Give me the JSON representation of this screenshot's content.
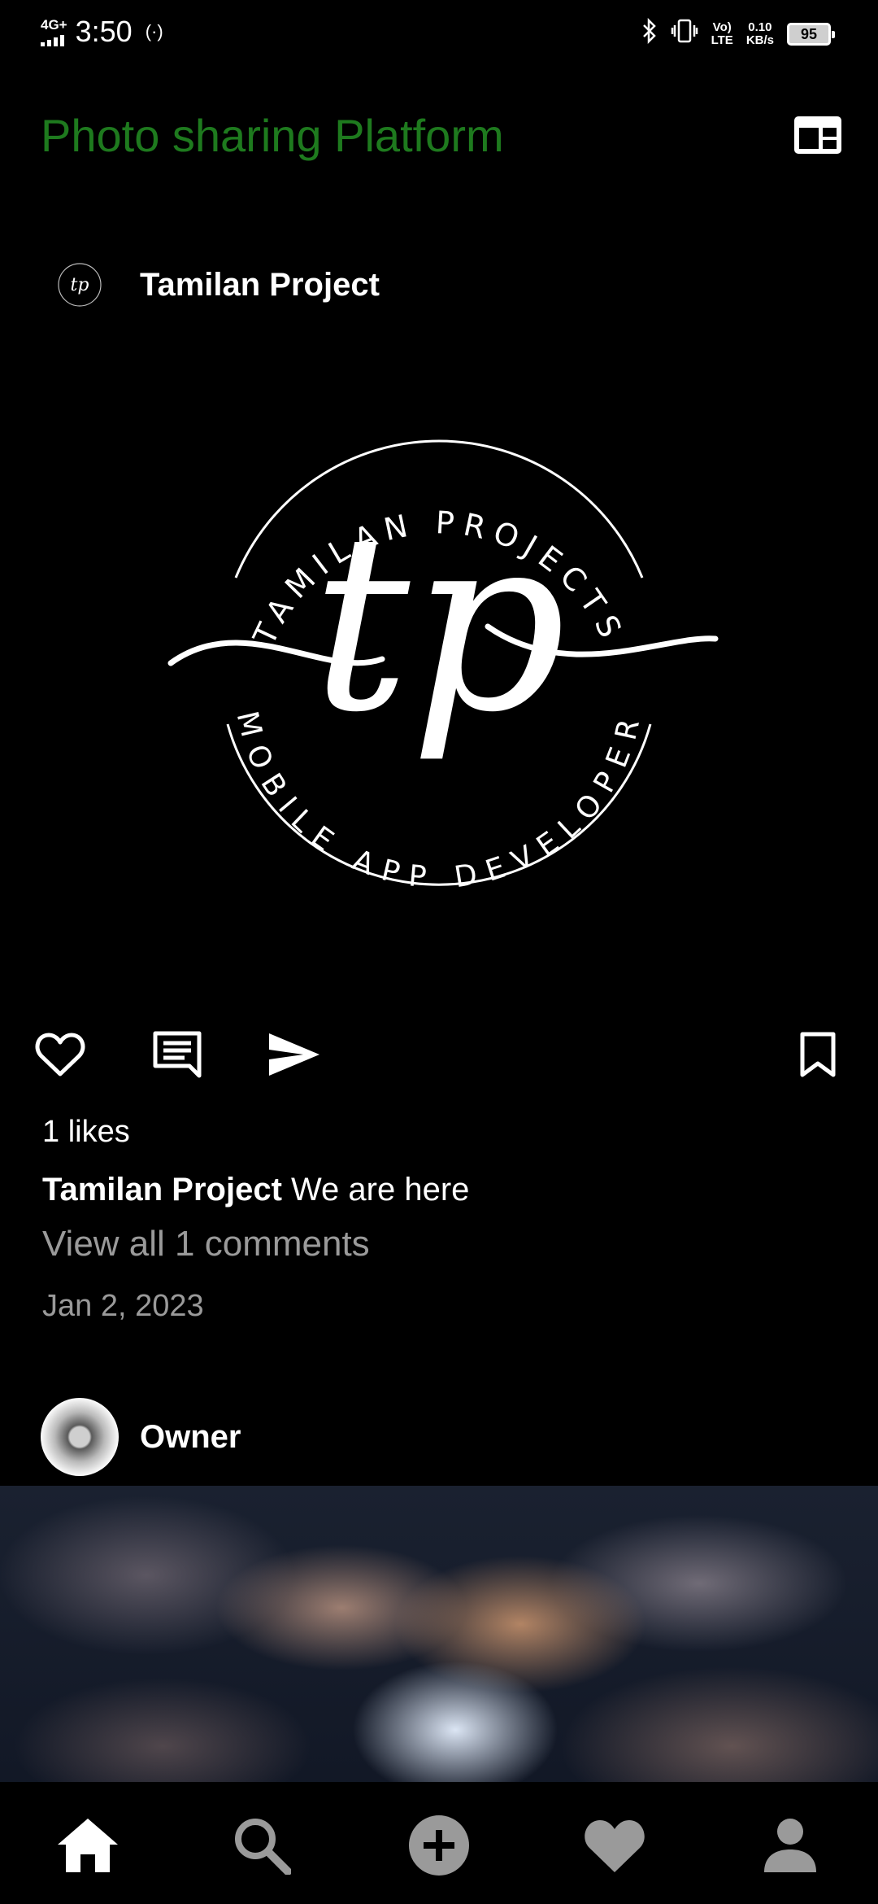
{
  "status_bar": {
    "network": "4G+",
    "time": "3:50",
    "volte": [
      "Vo)",
      "LTE"
    ],
    "speed": [
      "0.10",
      "KB/s"
    ],
    "battery": "95"
  },
  "app_bar": {
    "title": "Photo sharing Platform",
    "title_color": "#1e7a1e",
    "action_icon": "view-layout-icon"
  },
  "post1": {
    "username": "Tamilan Project",
    "logo_text": {
      "top_arc": "TAMILAN PROJECTS",
      "bottom_arc": "MOBILE APP DEVELOPER",
      "monogram": "tp"
    },
    "likes": "1 likes",
    "caption_user": "Tamilan Project",
    "caption_text": " We are here",
    "view_comments": "View all 1 comments",
    "date": "Jan 2, 2023"
  },
  "post2": {
    "username": "Owner"
  },
  "actions": [
    "like-icon",
    "comment-icon",
    "share-icon",
    "bookmark-icon"
  ],
  "bottom_nav": [
    "home-icon",
    "search-icon",
    "add-post-icon",
    "activity-icon",
    "profile-icon"
  ]
}
